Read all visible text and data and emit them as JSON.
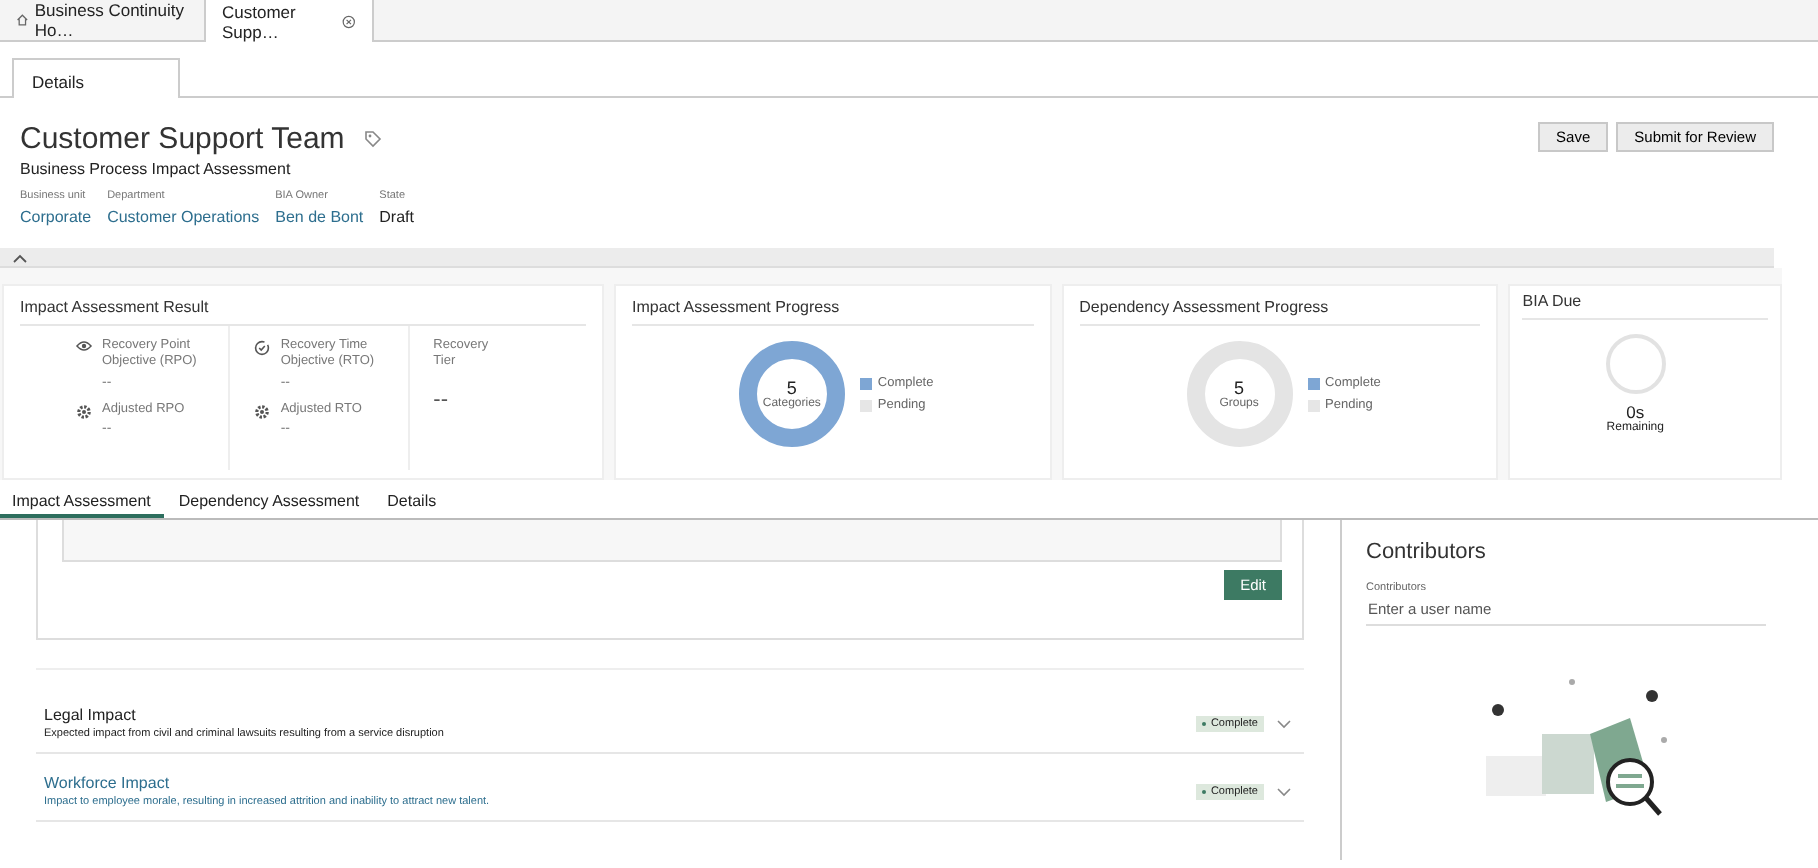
{
  "doc_tabs": [
    {
      "label": "Business Continuity Ho…",
      "selected": false,
      "kind": "home"
    },
    {
      "label": "Customer Supp…",
      "selected": true,
      "kind": "closable"
    }
  ],
  "sub_tabs": [
    {
      "label": "Details"
    }
  ],
  "header": {
    "title": "Customer Support Team",
    "subtitle": "Business Process Impact Assessment",
    "fields": [
      {
        "label": "Business unit",
        "value": "Corporate",
        "kind": "link"
      },
      {
        "label": "Department",
        "value": "Customer Operations",
        "kind": "link"
      },
      {
        "label": "BIA Owner",
        "value": "Ben de Bont",
        "kind": "link"
      },
      {
        "label": "State",
        "value": "Draft",
        "kind": "text"
      }
    ],
    "buttons": [
      "Save",
      "Submit for Review"
    ]
  },
  "result_card": {
    "title": "Impact Assessment Result",
    "columns": [
      {
        "metrics": [
          {
            "label": "Recovery Point Objective (RPO)",
            "value": "--",
            "kind": "eye"
          },
          {
            "label": "Adjusted RPO",
            "value": "--",
            "kind": "gear"
          }
        ]
      },
      {
        "metrics": [
          {
            "label": "Recovery Time Objective (RTO)",
            "value": "--",
            "kind": "clock"
          },
          {
            "label": "Adjusted RTO",
            "value": "--",
            "kind": "gear"
          }
        ]
      },
      {
        "metrics": [
          {
            "label": "Recovery Tier",
            "value": "--",
            "kind": "plain"
          }
        ]
      }
    ]
  },
  "progress_cards": [
    {
      "title": "Impact Assessment Progress",
      "count": "5",
      "unit": "Categories",
      "complete": true,
      "legend": [
        "Complete",
        "Pending"
      ]
    },
    {
      "title": "Dependency Assessment Progress",
      "count": "5",
      "unit": "Groups",
      "complete": false,
      "legend": [
        "Complete",
        "Pending"
      ]
    }
  ],
  "bia_card": {
    "title": "BIA Due",
    "value": "0s",
    "caption": "Remaining"
  },
  "main_tabs": [
    {
      "label": "Impact Assessment",
      "selected": true
    },
    {
      "label": "Dependency Assessment",
      "selected": false
    },
    {
      "label": "Details",
      "selected": false
    }
  ],
  "edit_button": "Edit",
  "impacts": [
    {
      "title": "Legal Impact",
      "description": "Expected impact from civil and criminal lawsuits resulting from a service disruption",
      "status": "Complete",
      "highlighted": false
    },
    {
      "title": "Workforce Impact",
      "description": "Impact to employee morale, resulting in increased attrition and inability to attract new talent.",
      "status": "Complete",
      "highlighted": true
    }
  ],
  "contributors": {
    "title": "Contributors",
    "field_label": "Contributors",
    "placeholder": "Enter a user name"
  }
}
